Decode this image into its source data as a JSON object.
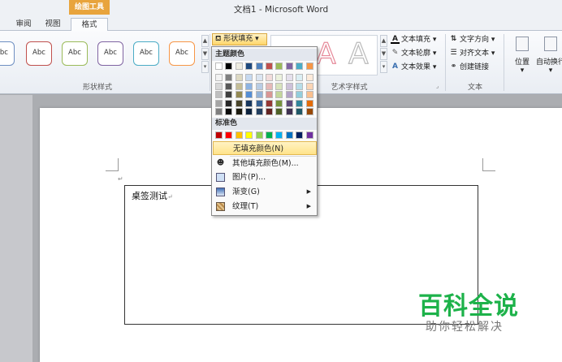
{
  "window": {
    "title": "文档1 - Microsoft Word",
    "contextual_tab": "绘图工具"
  },
  "tabs": [
    {
      "label": "审阅"
    },
    {
      "label": "视图"
    },
    {
      "label": "格式",
      "active": true
    }
  ],
  "ribbon": {
    "shape_styles": {
      "label": "形状样式",
      "thumbnail_text": "Abc",
      "thumb_colors": [
        "#6f8fc2",
        "#c0504d",
        "#9bbb59",
        "#8064a2",
        "#4bacc6",
        "#f79646"
      ]
    },
    "shape_fill_button": "形状填充",
    "wordart": {
      "label": "艺术字样式",
      "sample": "A"
    },
    "text_fill": "文本填充",
    "text_outline": "文本轮廓",
    "text_effects": "文本效果",
    "text_group": {
      "label": "文本",
      "direction": "文字方向",
      "align": "对齐文本",
      "link": "创建链接"
    },
    "position": "位置",
    "wrap": "自动换行"
  },
  "fill_menu": {
    "theme_colors_label": "主题颜色",
    "theme_top_row": [
      "#ffffff",
      "#000000",
      "#eeece1",
      "#1f497d",
      "#4f81bd",
      "#c0504d",
      "#9bbb59",
      "#8064a2",
      "#4bacc6",
      "#f79646"
    ],
    "theme_shades": [
      [
        "#f2f2f2",
        "#7f7f7f",
        "#ddd9c3",
        "#c6d9f0",
        "#dbe5f1",
        "#f2dcdb",
        "#ebf1dd",
        "#e5e0ec",
        "#dbeef3",
        "#fdeada"
      ],
      [
        "#d8d8d8",
        "#595959",
        "#c4bd97",
        "#8db3e2",
        "#b8cce4",
        "#e5b9b7",
        "#d7e3bc",
        "#ccc1d9",
        "#b7dde8",
        "#fbd5b5"
      ],
      [
        "#bfbfbf",
        "#3f3f3f",
        "#938953",
        "#548dd4",
        "#95b3d7",
        "#d99694",
        "#c3d69b",
        "#b2a2c7",
        "#92cddc",
        "#fac08f"
      ],
      [
        "#a5a5a5",
        "#262626",
        "#494429",
        "#17365d",
        "#366092",
        "#953734",
        "#76923c",
        "#5f497a",
        "#31859b",
        "#e36c09"
      ],
      [
        "#7f7f7f",
        "#0c0c0c",
        "#1d1b10",
        "#0f243e",
        "#244061",
        "#632423",
        "#4f6128",
        "#3f3151",
        "#205867",
        "#974806"
      ]
    ],
    "standard_colors_label": "标准色",
    "standard_colors": [
      "#c00000",
      "#ff0000",
      "#ffc000",
      "#ffff00",
      "#92d050",
      "#00b050",
      "#00b0f0",
      "#0070c0",
      "#002060",
      "#7030a0"
    ],
    "items": [
      {
        "label": "无填充颜色(N)",
        "highlighted": true
      },
      {
        "label": "其他填充颜色(M)...",
        "icon": "palette-icon"
      },
      {
        "label": "图片(P)...",
        "icon": "picture-icon"
      },
      {
        "label": "渐变(G)",
        "icon": "gradient-icon",
        "submenu": true
      },
      {
        "label": "纹理(T)",
        "icon": "texture-icon",
        "submenu": true
      }
    ]
  },
  "document": {
    "textbox_text": "桌签测试",
    "paragraph_mark": "↵"
  },
  "watermark": {
    "title": "百科全说",
    "subtitle": "助你轻松解决"
  }
}
